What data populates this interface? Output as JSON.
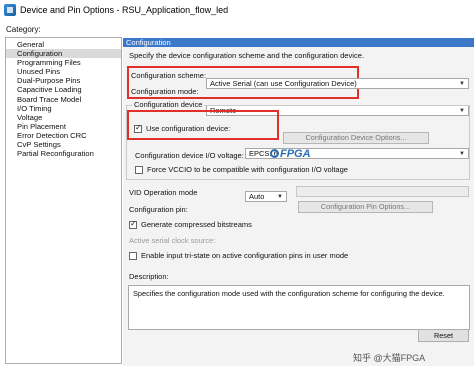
{
  "window": {
    "title": "Device and Pin Options - RSU_Application_flow_led"
  },
  "category": {
    "label": "Category:",
    "items": [
      {
        "label": "General"
      },
      {
        "label": "Configuration"
      },
      {
        "label": "Programming Files"
      },
      {
        "label": "Unused Pins"
      },
      {
        "label": "Dual-Purpose Pins"
      },
      {
        "label": "Capacitive Loading"
      },
      {
        "label": "Board Trace Model"
      },
      {
        "label": "I/O Timing"
      },
      {
        "label": "Voltage"
      },
      {
        "label": "Pin Placement"
      },
      {
        "label": "Error Detection CRC"
      },
      {
        "label": "CvP Settings"
      },
      {
        "label": "Partial Reconfiguration"
      }
    ],
    "selected": "Configuration"
  },
  "configuration": {
    "header": "Configuration",
    "description": "Specify the device configuration scheme and the configuration device.",
    "scheme_label": "Configuration scheme:",
    "scheme_value": "Active Serial (can use Configuration Device)",
    "mode_label": "Configuration mode:",
    "mode_value": "Remote",
    "device_group_title": "Configuration device",
    "use_device_label": "Use configuration device:",
    "use_device_checked": true,
    "device_value": "EPCS16",
    "device_options_button": "Configuration Device Options...",
    "io_voltage_label": "Configuration device I/O voltage:",
    "io_voltage_value": "Auto",
    "force_vccio_label": "Force VCCIO to be compatible with configuration I/O voltage",
    "force_vccio_checked": false,
    "vid_label": "VID Operation mode",
    "config_pin_label": "Configuration pin:",
    "config_pin_button": "Configuration Pin Options...",
    "compressed_label": "Generate compressed bitstreams",
    "compressed_checked": true,
    "clock_source_label": "Active serial clock source:",
    "tristate_label": "Enable input tri-state on active configuration pins in user mode",
    "tristate_checked": false
  },
  "description_box": {
    "label": "Description:",
    "text": "Specifies the configuration mode used with the configuration scheme for configuring the device."
  },
  "reset_button": "Reset",
  "watermark": {
    "logo_text": "FPGA",
    "footer_text": "知乎 @大猫FPGA"
  }
}
